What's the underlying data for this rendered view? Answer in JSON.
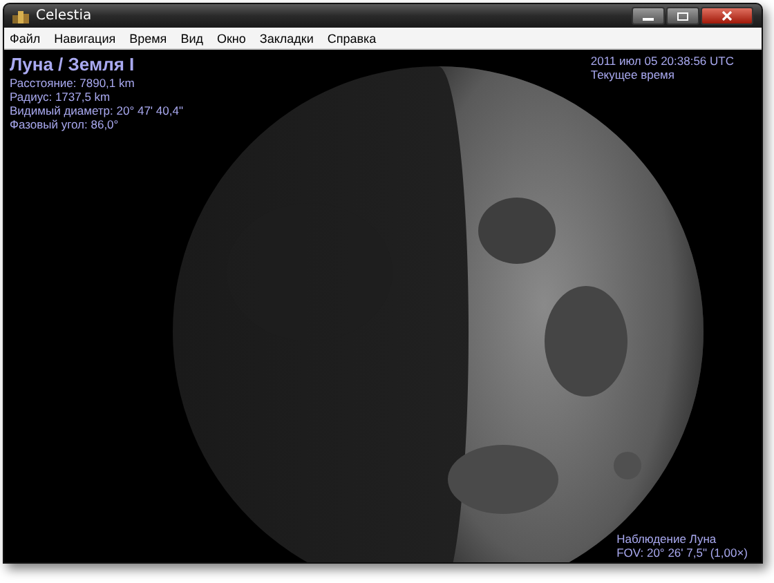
{
  "window": {
    "title": "Celestia"
  },
  "menu": [
    "Файл",
    "Навигация",
    "Время",
    "Вид",
    "Окно",
    "Закладки",
    "Справка"
  ],
  "object_info": {
    "title": "Луна / Земля I",
    "lines": [
      "Расстояние: 7890,1 km",
      "Радиус: 1737,5 km",
      "Видимый диаметр: 20° 47' 40,4\"",
      "Фазовый угол: 86,0°"
    ]
  },
  "time_info": {
    "datetime": "2011 июл 05 20:38:56 UTC",
    "mode": "Текущее время"
  },
  "view_info": {
    "target": "Наблюдение Луна",
    "fov": "FOV: 20° 26' 7,5\" (1,00×)"
  }
}
